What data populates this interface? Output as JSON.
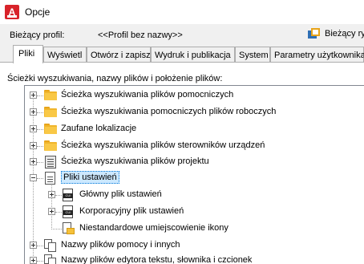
{
  "window": {
    "title": "Opcje"
  },
  "profile": {
    "label": "Bieżący profil:",
    "value": "<<Profil bez nazwy>>",
    "button_label": "Bieżący ry"
  },
  "tabs": [
    {
      "label": "Pliki",
      "active": true
    },
    {
      "label": "Wyświetl",
      "active": false
    },
    {
      "label": "Otwórz i zapisz",
      "active": false
    },
    {
      "label": "Wydruk i publikacja",
      "active": false
    },
    {
      "label": "System",
      "active": false
    },
    {
      "label": "Parametry użytkownika",
      "active": false
    }
  ],
  "panel": {
    "label": "Ścieżki wyszukiwania, nazwy plików i położenie plików:"
  },
  "tree": {
    "items": [
      {
        "label": "Ścieżka wyszukiwania plików pomocniczych",
        "icon": "folder-icon",
        "expanded": false
      },
      {
        "label": "Ścieżka wyszukiwania pomocniczych plików roboczych",
        "icon": "folder-icon",
        "expanded": false
      },
      {
        "label": "Zaufane lokalizacje",
        "icon": "folder-icon",
        "expanded": false
      },
      {
        "label": "Ścieżka wyszukiwania plików sterowników urządzeń",
        "icon": "folder-icon",
        "expanded": false
      },
      {
        "label": "Ścieżka wyszukiwania plików projektu",
        "icon": "project-icon",
        "expanded": false
      },
      {
        "label": "Pliki ustawień",
        "icon": "document-icon",
        "expanded": true,
        "selected": true
      },
      {
        "label": "Główny plik ustawień",
        "icon": "cuix-file-icon",
        "expanded": false
      },
      {
        "label": "Korporacyjny plik ustawień",
        "icon": "cuix-file-icon",
        "expanded": false
      },
      {
        "label": "Niestandardowe umiejscowienie ikony",
        "icon": "file-folder-icon",
        "expanded": null
      },
      {
        "label": "Nazwy plików pomocy i innych",
        "icon": "multi-doc-icon",
        "expanded": false
      },
      {
        "label": "Nazwy plików edytora tekstu, słownika i czcionek",
        "icon": "multi-doc-icon",
        "expanded": false
      }
    ]
  },
  "colors": {
    "selection": "#cce8ff",
    "folder": "#f9c846",
    "app_icon": "#d8232a"
  }
}
